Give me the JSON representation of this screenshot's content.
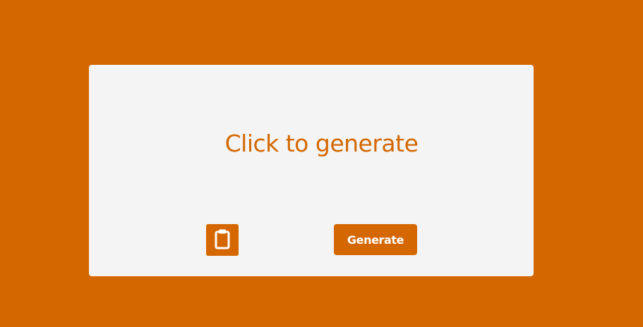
{
  "colors": {
    "background": "#d46700",
    "card": "#f4f4f4",
    "accent": "#d46700",
    "button_text": "#ffffff"
  },
  "output": {
    "text": "Click to generate"
  },
  "copy_button": {
    "icon": "clipboard-icon"
  },
  "generate_button": {
    "label": "Generate"
  }
}
